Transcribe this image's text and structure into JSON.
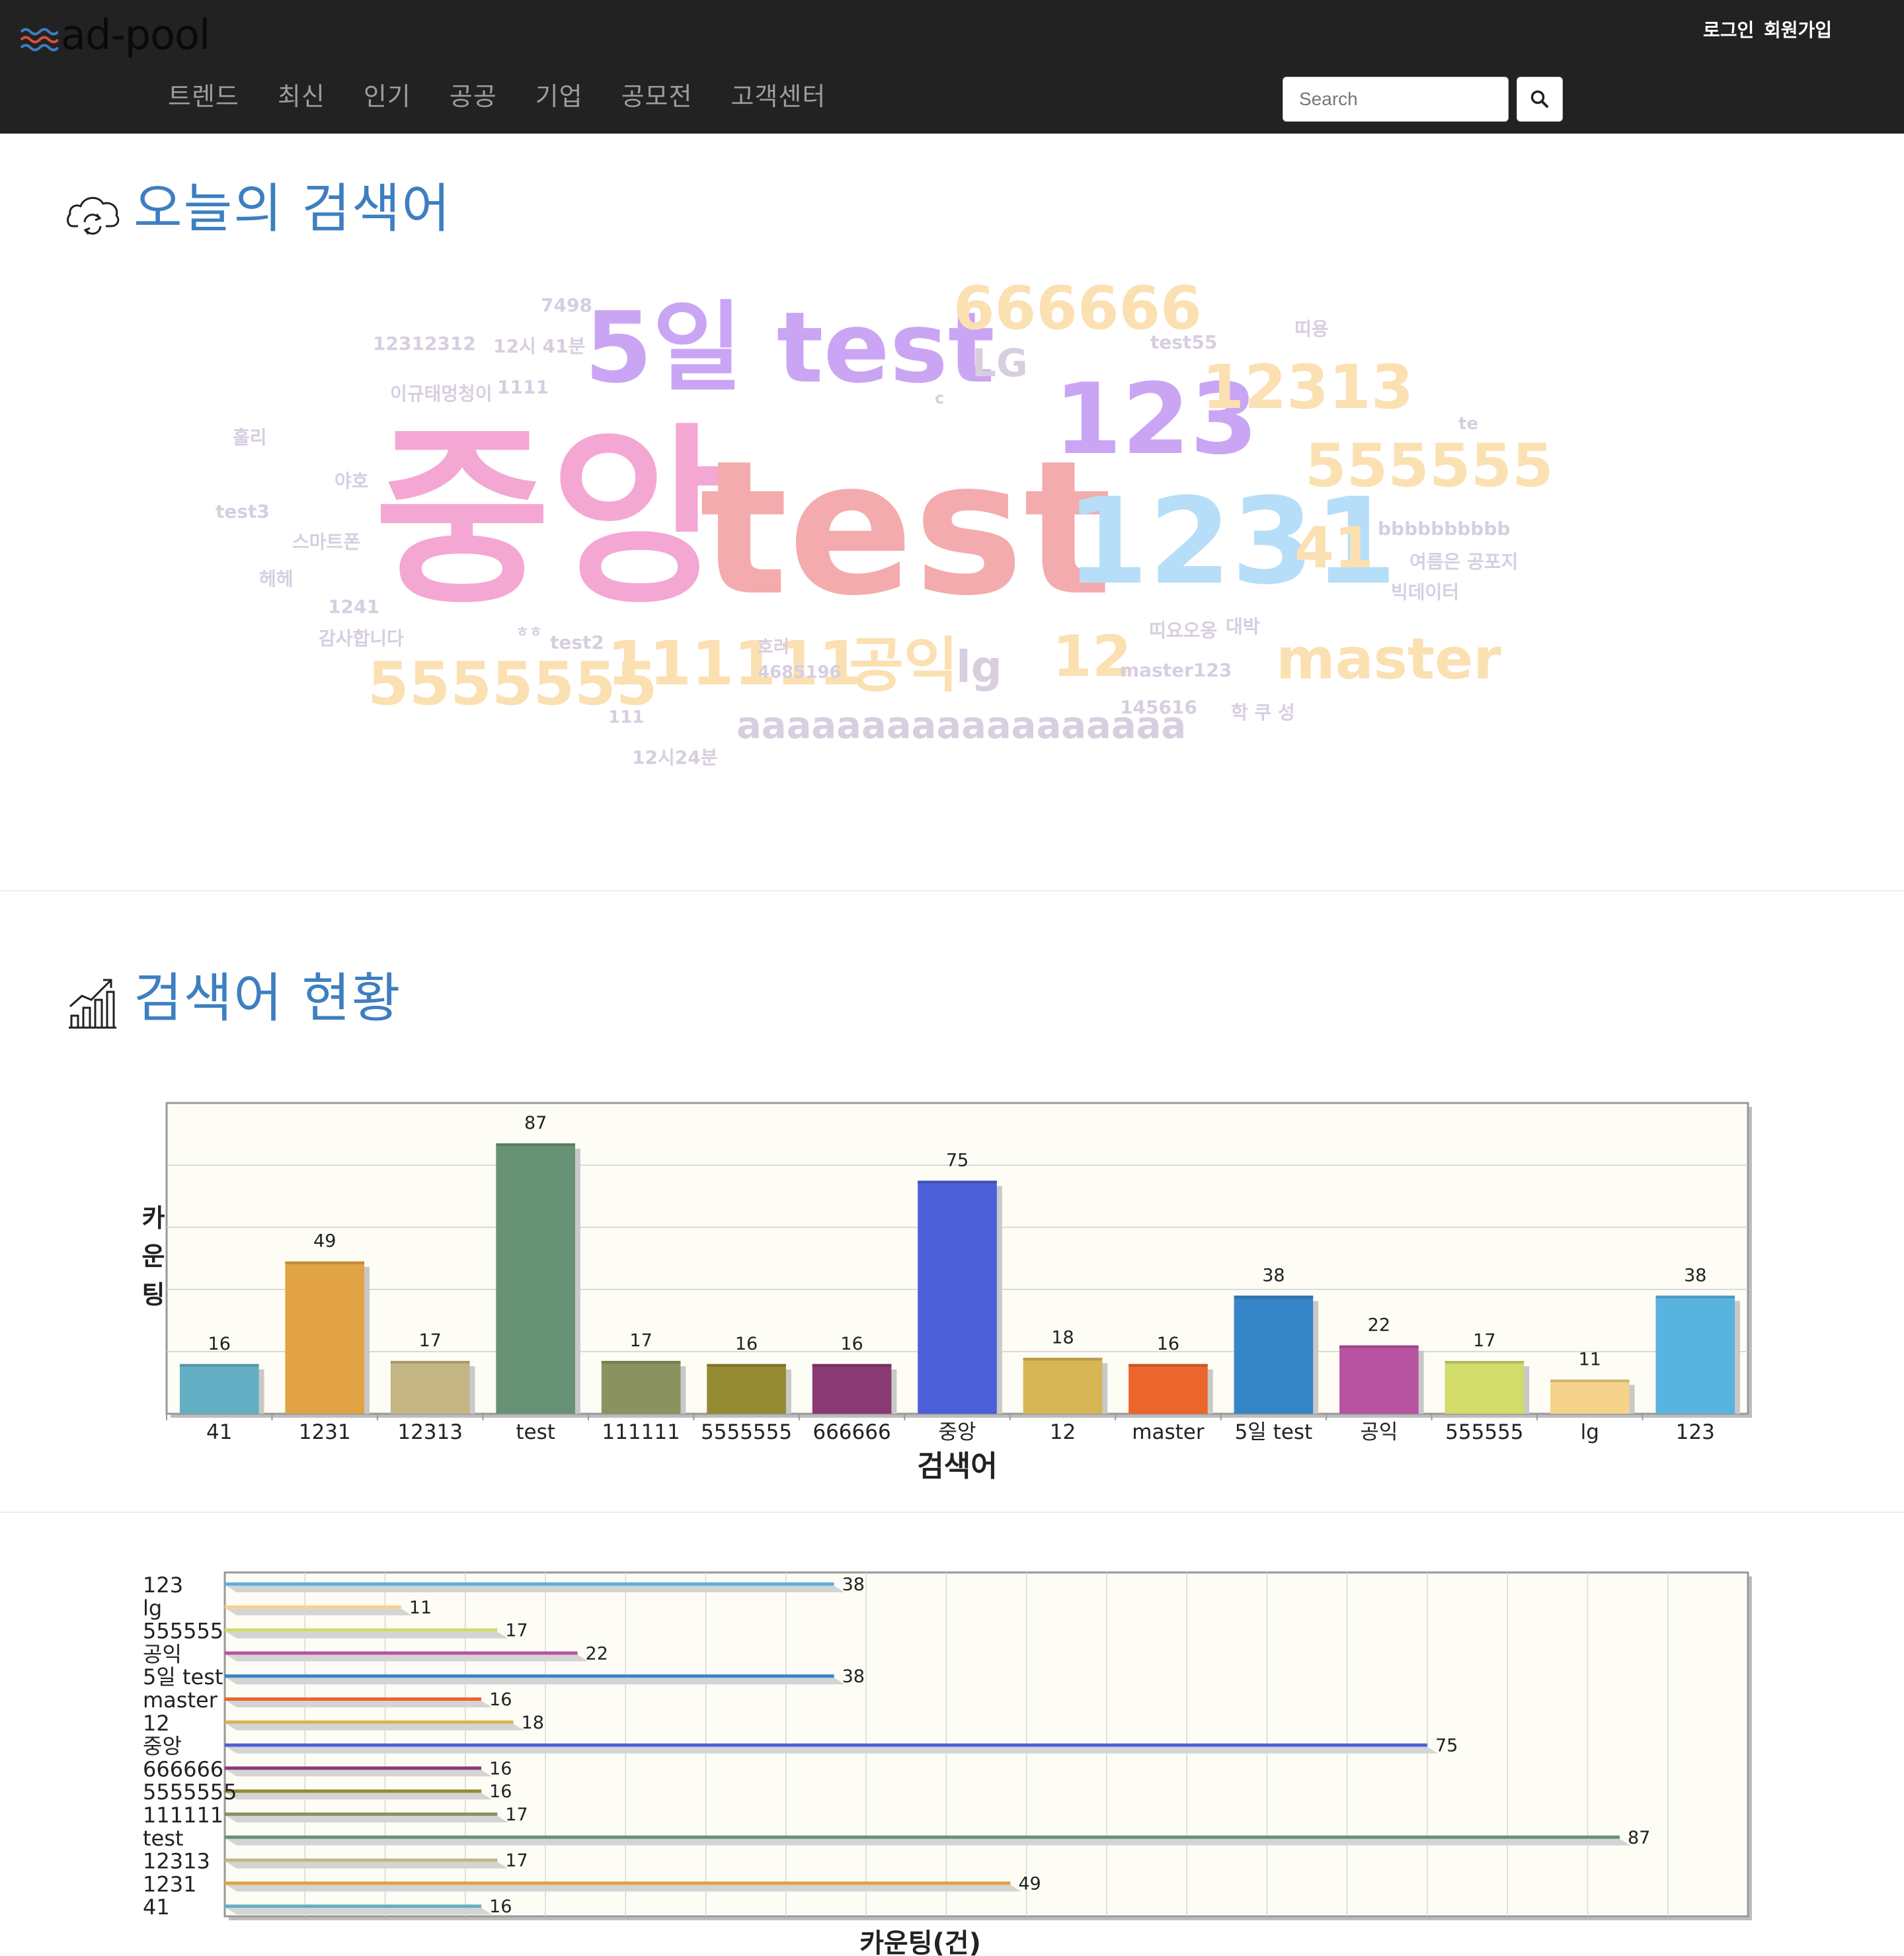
{
  "header": {
    "logo_text": "ad-pool",
    "login_label": "로그인",
    "signup_label": "회원가입",
    "nav": [
      "트렌드",
      "최신",
      "인기",
      "공공",
      "기업",
      "공모전",
      "고객센터"
    ],
    "search_placeholder": "Search"
  },
  "wordcloud_section": {
    "title": "오늘의 검색어",
    "words": [
      {
        "text": "중앙",
        "color": "#f4a7d3"
      },
      {
        "text": "test",
        "color": "#f4abad"
      },
      {
        "text": "5일 test",
        "color": "#caa5f4"
      },
      {
        "text": "1231",
        "color": "#b6def8"
      },
      {
        "text": "123",
        "color": "#caa5f4"
      },
      {
        "text": "666666",
        "color": "#fbe0b2"
      },
      {
        "text": "12313",
        "color": "#fbe0b2"
      },
      {
        "text": "555555",
        "color": "#fbe0b2"
      },
      {
        "text": "41",
        "color": "#fbe0b2"
      },
      {
        "text": "5555555",
        "color": "#fbe0b2"
      },
      {
        "text": "111111",
        "color": "#fbe0b2"
      },
      {
        "text": "공익",
        "color": "#fbe0b2"
      },
      {
        "text": "lg",
        "color": "#d7cee0"
      },
      {
        "text": "12",
        "color": "#fbe0b2"
      },
      {
        "text": "master",
        "color": "#fbe0b2"
      },
      {
        "text": "aaaaaaaaaaaaaaaaaa",
        "color": "#d7cee0"
      },
      {
        "text": "LG",
        "color": "#d7cee0"
      },
      {
        "text": "7498",
        "color": "#d7cee0"
      },
      {
        "text": "12312312",
        "color": "#d7cee0"
      },
      {
        "text": "12시 41분",
        "color": "#d7cee0"
      },
      {
        "text": "이규태멍청이",
        "color": "#d7cee0"
      },
      {
        "text": "1111",
        "color": "#d7cee0"
      },
      {
        "text": "c",
        "color": "#d7cee0"
      },
      {
        "text": "test55",
        "color": "#d7cee0"
      },
      {
        "text": "띠용",
        "color": "#d7cee0"
      },
      {
        "text": "te",
        "color": "#d7cee0"
      },
      {
        "text": "훌리",
        "color": "#d7cee0"
      },
      {
        "text": "야호",
        "color": "#d7cee0"
      },
      {
        "text": "test3",
        "color": "#d7cee0"
      },
      {
        "text": "스마트폰",
        "color": "#d7cee0"
      },
      {
        "text": "헤헤",
        "color": "#d7cee0"
      },
      {
        "text": "1241",
        "color": "#d7cee0"
      },
      {
        "text": "감사합니다",
        "color": "#d7cee0"
      },
      {
        "text": "ㅎㅎ",
        "color": "#d7cee0"
      },
      {
        "text": "test2",
        "color": "#d7cee0"
      },
      {
        "text": "호러",
        "color": "#d7cee0"
      },
      {
        "text": "4685196",
        "color": "#d7cee0"
      },
      {
        "text": "111",
        "color": "#d7cee0"
      },
      {
        "text": "12시24분",
        "color": "#d7cee0"
      },
      {
        "text": "bbbbbbbbbb",
        "color": "#d7cee0"
      },
      {
        "text": "여름은 공포지",
        "color": "#d7cee0"
      },
      {
        "text": "빅데이터",
        "color": "#d7cee0"
      },
      {
        "text": "띠요오옹",
        "color": "#d7cee0"
      },
      {
        "text": "대박",
        "color": "#d7cee0"
      },
      {
        "text": "master123",
        "color": "#d7cee0"
      },
      {
        "text": "145616",
        "color": "#d7cee0"
      },
      {
        "text": "학 쿠 성",
        "color": "#d7cee0"
      }
    ]
  },
  "stats_section": {
    "title": "검색어 현황"
  },
  "chart_data": [
    {
      "type": "bar",
      "categories": [
        "41",
        "1231",
        "12313",
        "test",
        "111111",
        "5555555",
        "666666",
        "중앙",
        "12",
        "master",
        "5일 test",
        "공익",
        "555555",
        "lg",
        "123"
      ],
      "values": [
        16,
        49,
        17,
        87,
        17,
        16,
        16,
        75,
        18,
        16,
        38,
        22,
        17,
        11,
        38
      ],
      "colors": [
        "#64afc3",
        "#e1a344",
        "#c4b584",
        "#679175",
        "#8a935f",
        "#948a31",
        "#8a3a72",
        "#4b60d9",
        "#d6b554",
        "#eb652c",
        "#3585c7",
        "#b753a1",
        "#d1dc6a",
        "#f5d38a",
        "#58b3df"
      ],
      "xlabel": "검색어",
      "ylabel": "카운팅",
      "ylim": [
        0,
        100
      ],
      "grid": true,
      "data_labels": true
    },
    {
      "type": "bar",
      "orientation": "horizontal",
      "categories": [
        "123",
        "lg",
        "555555",
        "공익",
        "5일 test",
        "master",
        "12",
        "중앙",
        "666666",
        "5555555",
        "111111",
        "test",
        "12313",
        "1231",
        "41"
      ],
      "values": [
        38,
        11,
        17,
        22,
        38,
        16,
        18,
        75,
        16,
        16,
        17,
        87,
        17,
        49,
        16
      ],
      "colors": [
        "#58b3df",
        "#f5d38a",
        "#d1dc6a",
        "#b753a1",
        "#3585c7",
        "#eb652c",
        "#d6b554",
        "#4b60d9",
        "#8a3a72",
        "#948a31",
        "#8a935f",
        "#679175",
        "#c4b584",
        "#e1a344",
        "#64afc3"
      ],
      "xlabel": "카운팅(건)",
      "xlim": [
        0,
        95
      ],
      "grid": true,
      "data_labels": true
    }
  ]
}
